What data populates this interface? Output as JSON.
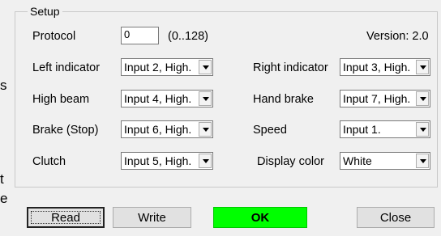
{
  "background_fragments": {
    "s": "s",
    "t": "t",
    "e": "e"
  },
  "setup": {
    "legend": "Setup",
    "protocol_label": "Protocol",
    "protocol_value": "0",
    "protocol_range": "(0..128)",
    "version": "Version: 2.0",
    "fields": {
      "left_indicator": {
        "label": "Left indicator",
        "value": "Input 2, High."
      },
      "right_indicator": {
        "label": "Right indicator",
        "value": "Input 3, High."
      },
      "high_beam": {
        "label": "High beam",
        "value": "Input 4, High."
      },
      "hand_brake": {
        "label": "Hand brake",
        "value": "Input 7, High."
      },
      "brake": {
        "label": "Brake (Stop)",
        "value": "Input 6, High."
      },
      "speed": {
        "label": "Speed",
        "value": "Input 1."
      },
      "clutch": {
        "label": "Clutch",
        "value": "Input 5, High."
      },
      "display_color": {
        "label": "Display color",
        "value": "White"
      }
    }
  },
  "buttons": {
    "read": "Read",
    "write": "Write",
    "ok": "OK",
    "close": "Close"
  },
  "colors": {
    "ok_background": "#00ff00"
  }
}
